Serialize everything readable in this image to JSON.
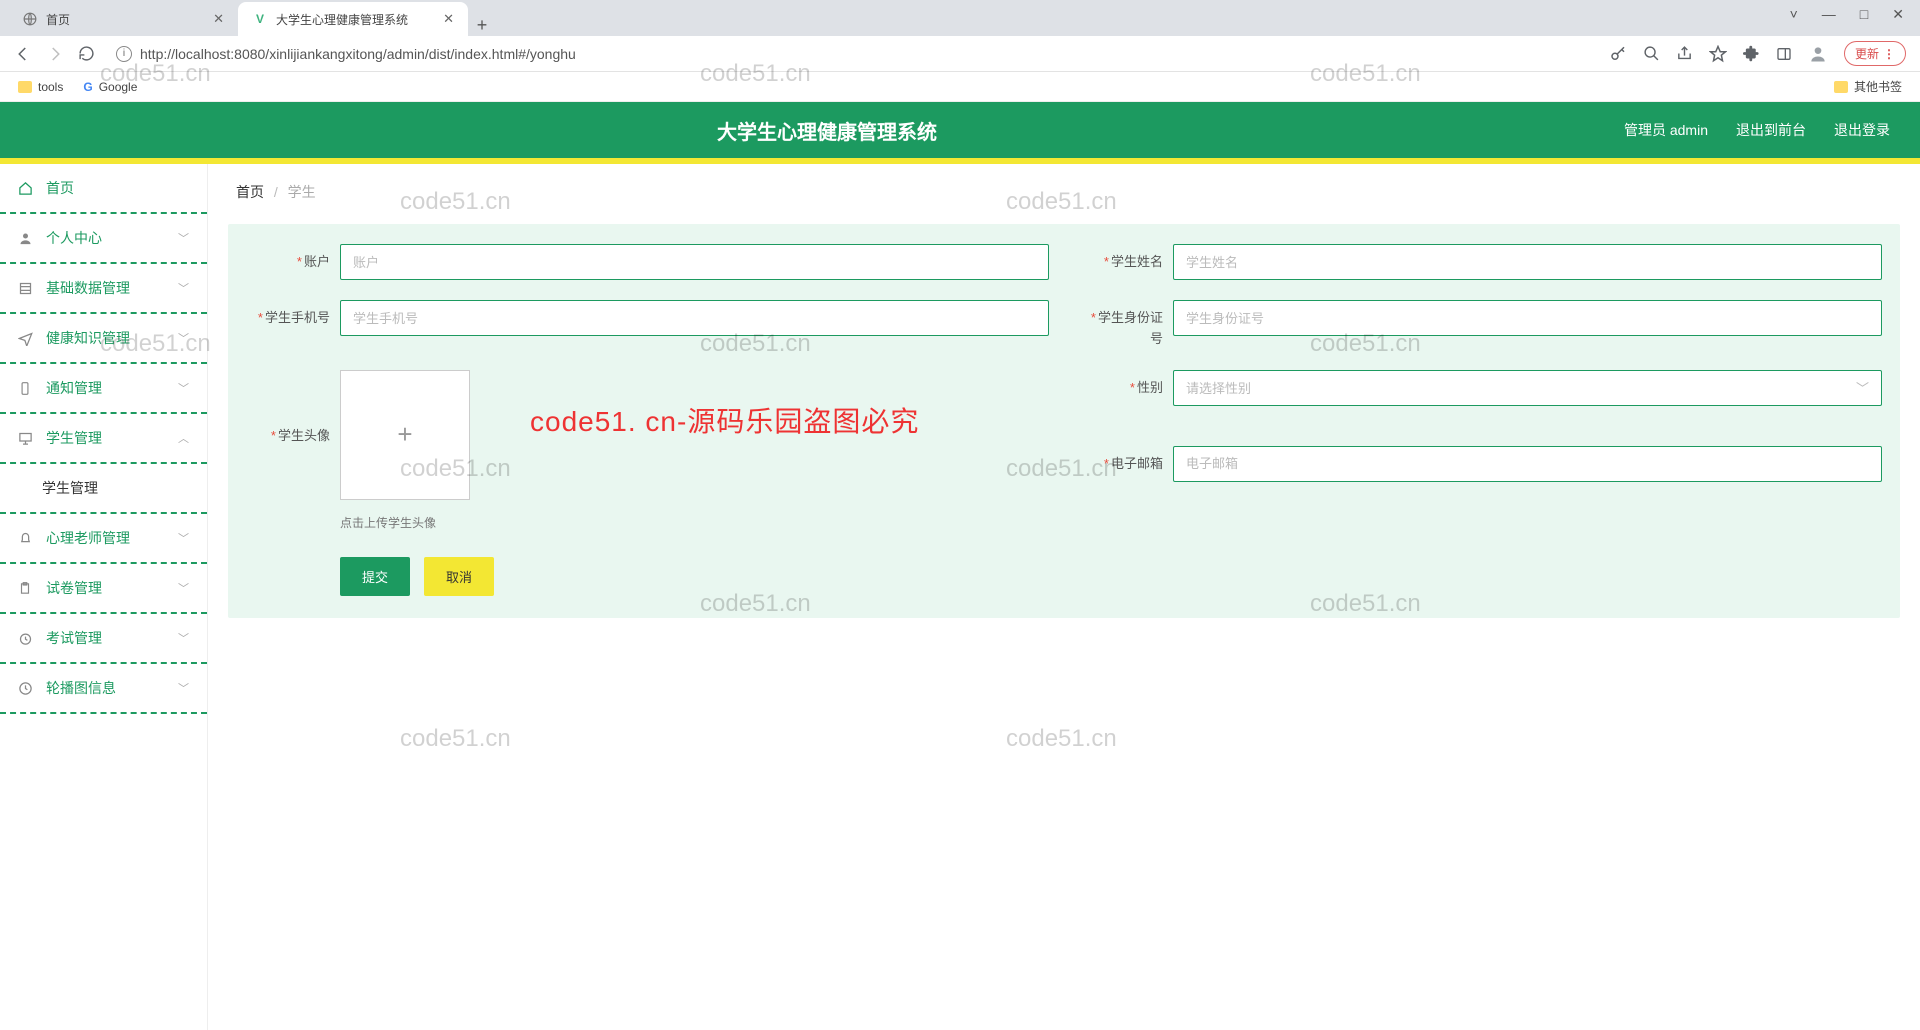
{
  "browser": {
    "tabs": [
      {
        "title": "首页",
        "active": false
      },
      {
        "title": "大学生心理健康管理系统",
        "active": true
      }
    ],
    "url_display": "http://localhost:8080/xinlijiankangxitong/admin/dist/index.html#/yonghu",
    "update_label": "更新",
    "bookmarks": {
      "tools": "tools",
      "google": "Google",
      "other": "其他书签"
    },
    "win": {
      "min": "—",
      "max": "□",
      "close": "✕",
      "drop": "˅"
    }
  },
  "header": {
    "title": "大学生心理健康管理系统",
    "admin_label": "管理员 admin",
    "to_front": "退出到前台",
    "logout": "退出登录"
  },
  "sidebar": {
    "items": [
      {
        "label": "首页",
        "icon": "home",
        "expandable": false
      },
      {
        "label": "个人中心",
        "icon": "user",
        "expandable": true,
        "expanded": false
      },
      {
        "label": "基础数据管理",
        "icon": "data",
        "expandable": true,
        "expanded": false
      },
      {
        "label": "健康知识管理",
        "icon": "send",
        "expandable": true,
        "expanded": false
      },
      {
        "label": "通知管理",
        "icon": "phone",
        "expandable": true,
        "expanded": false
      },
      {
        "label": "学生管理",
        "icon": "monitor",
        "expandable": true,
        "expanded": true,
        "children": [
          {
            "label": "学生管理"
          }
        ]
      },
      {
        "label": "心理老师管理",
        "icon": "bell",
        "expandable": true,
        "expanded": false
      },
      {
        "label": "试卷管理",
        "icon": "clip",
        "expandable": true,
        "expanded": false
      },
      {
        "label": "考试管理",
        "icon": "clock",
        "expandable": true,
        "expanded": false
      },
      {
        "label": "轮播图信息",
        "icon": "image",
        "expandable": true,
        "expanded": false
      }
    ]
  },
  "breadcrumb": {
    "home": "首页",
    "sep": "/",
    "current": "学生"
  },
  "form": {
    "account": {
      "label": "账户",
      "placeholder": "账户",
      "value": ""
    },
    "student_name": {
      "label": "学生姓名",
      "placeholder": "学生姓名",
      "value": ""
    },
    "phone": {
      "label": "学生手机号",
      "placeholder": "学生手机号",
      "value": ""
    },
    "id_no": {
      "label": "学生身份证号",
      "placeholder": "学生身份证号",
      "value": ""
    },
    "avatar": {
      "label": "学生头像",
      "tip": "点击上传学生头像"
    },
    "gender": {
      "label": "性别",
      "placeholder": "请选择性别",
      "value": ""
    },
    "email": {
      "label": "电子邮箱",
      "placeholder": "电子邮箱",
      "value": ""
    },
    "submit": "提交",
    "cancel": "取消"
  },
  "watermarks": {
    "text": "code51.cn",
    "red": "code51. cn-源码乐园盗图必究"
  }
}
